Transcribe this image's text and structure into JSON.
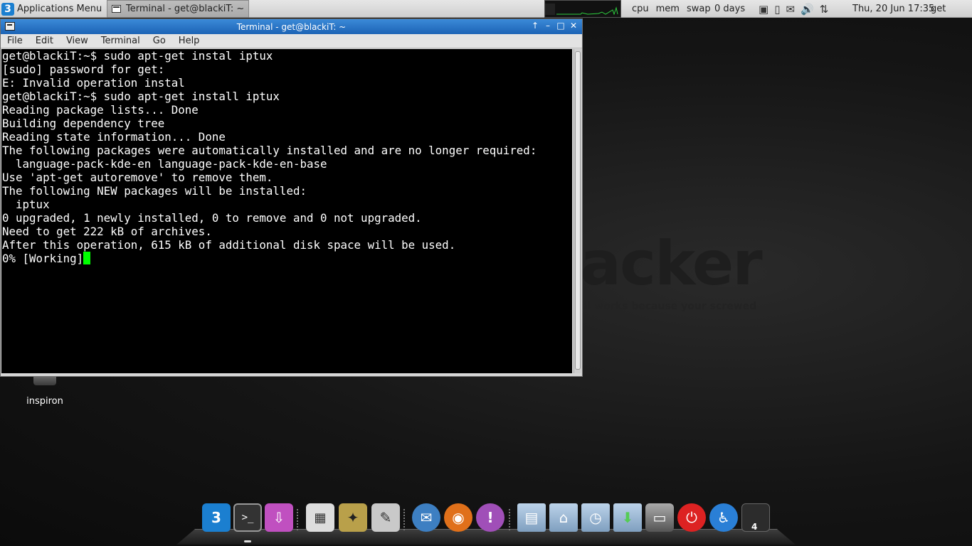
{
  "top_panel": {
    "apps_menu_label": "Applications Menu",
    "task_label": "Terminal - get@blackiT: ~",
    "sysmon": [
      "cpu",
      "mem",
      "swap"
    ],
    "uptime": "0 days",
    "clock": "Thu, 20 Jun  17:35",
    "user": "get"
  },
  "window": {
    "title": "Terminal - get@blackiT: ~",
    "menu": [
      "File",
      "Edit",
      "View",
      "Terminal",
      "Go",
      "Help"
    ]
  },
  "terminal": {
    "lines": [
      "get@blackiT:~$ sudo apt-get instal iptux",
      "[sudo] password for get:",
      "E: Invalid operation instal",
      "get@blackiT:~$ sudo apt-get install iptux",
      "Reading package lists... Done",
      "Building dependency tree",
      "Reading state information... Done",
      "The following packages were automatically installed and are no longer required:",
      "  language-pack-kde-en language-pack-kde-en-base",
      "Use 'apt-get autoremove' to remove them.",
      "The following NEW packages will be installed:",
      "  iptux",
      "0 upgraded, 1 newly installed, 0 to remove and 0 not upgraded.",
      "Need to get 222 kB of archives.",
      "After this operation, 615 kB of additional disk space will be used."
    ],
    "last_line": "0% [Working]",
    "cursor_color": "#00ff00"
  },
  "desktop": {
    "icon_label": "inspiron",
    "wallpaper_text": "acker",
    "wallpaper_sub": "ill works because your screwed"
  },
  "dock": {
    "workspace_number": "4"
  }
}
